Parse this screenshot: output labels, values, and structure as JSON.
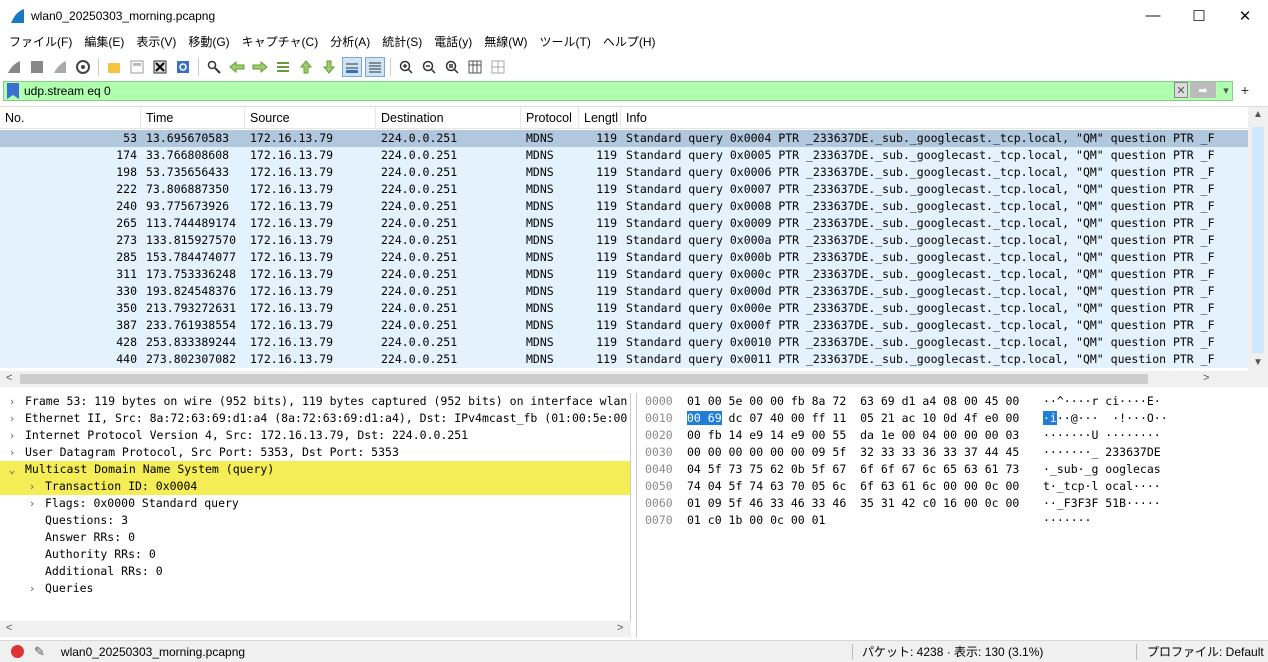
{
  "window": {
    "title": "wlan0_20250303_morning.pcapng",
    "minimize": "—",
    "maximize": "☐",
    "close": "✕"
  },
  "menu": [
    "ファイル(F)",
    "編集(E)",
    "表示(V)",
    "移動(G)",
    "キャプチャ(C)",
    "分析(A)",
    "統計(S)",
    "電話(y)",
    "無線(W)",
    "ツール(T)",
    "ヘルプ(H)"
  ],
  "filter": {
    "value": "udp.stream eq 0",
    "add": "+"
  },
  "columns": [
    "No.",
    "Time",
    "Source",
    "Destination",
    "Protocol",
    "Lengtl",
    "Info"
  ],
  "packets": [
    {
      "no": "53",
      "time": "13.695670583",
      "src": "172.16.13.79",
      "dst": "224.0.0.251",
      "proto": "MDNS",
      "len": "119",
      "info": "Standard query 0x0004 PTR _233637DE._sub._googlecast._tcp.local, \"QM\" question PTR _F"
    },
    {
      "no": "174",
      "time": "33.766808608",
      "src": "172.16.13.79",
      "dst": "224.0.0.251",
      "proto": "MDNS",
      "len": "119",
      "info": "Standard query 0x0005 PTR _233637DE._sub._googlecast._tcp.local, \"QM\" question PTR _F"
    },
    {
      "no": "198",
      "time": "53.735656433",
      "src": "172.16.13.79",
      "dst": "224.0.0.251",
      "proto": "MDNS",
      "len": "119",
      "info": "Standard query 0x0006 PTR _233637DE._sub._googlecast._tcp.local, \"QM\" question PTR _F"
    },
    {
      "no": "222",
      "time": "73.806887350",
      "src": "172.16.13.79",
      "dst": "224.0.0.251",
      "proto": "MDNS",
      "len": "119",
      "info": "Standard query 0x0007 PTR _233637DE._sub._googlecast._tcp.local, \"QM\" question PTR _F"
    },
    {
      "no": "240",
      "time": "93.775673926",
      "src": "172.16.13.79",
      "dst": "224.0.0.251",
      "proto": "MDNS",
      "len": "119",
      "info": "Standard query 0x0008 PTR _233637DE._sub._googlecast._tcp.local, \"QM\" question PTR _F"
    },
    {
      "no": "265",
      "time": "113.744489174",
      "src": "172.16.13.79",
      "dst": "224.0.0.251",
      "proto": "MDNS",
      "len": "119",
      "info": "Standard query 0x0009 PTR _233637DE._sub._googlecast._tcp.local, \"QM\" question PTR _F"
    },
    {
      "no": "273",
      "time": "133.815927570",
      "src": "172.16.13.79",
      "dst": "224.0.0.251",
      "proto": "MDNS",
      "len": "119",
      "info": "Standard query 0x000a PTR _233637DE._sub._googlecast._tcp.local, \"QM\" question PTR _F"
    },
    {
      "no": "285",
      "time": "153.784474077",
      "src": "172.16.13.79",
      "dst": "224.0.0.251",
      "proto": "MDNS",
      "len": "119",
      "info": "Standard query 0x000b PTR _233637DE._sub._googlecast._tcp.local, \"QM\" question PTR _F"
    },
    {
      "no": "311",
      "time": "173.753336248",
      "src": "172.16.13.79",
      "dst": "224.0.0.251",
      "proto": "MDNS",
      "len": "119",
      "info": "Standard query 0x000c PTR _233637DE._sub._googlecast._tcp.local, \"QM\" question PTR _F"
    },
    {
      "no": "330",
      "time": "193.824548376",
      "src": "172.16.13.79",
      "dst": "224.0.0.251",
      "proto": "MDNS",
      "len": "119",
      "info": "Standard query 0x000d PTR _233637DE._sub._googlecast._tcp.local, \"QM\" question PTR _F"
    },
    {
      "no": "350",
      "time": "213.793272631",
      "src": "172.16.13.79",
      "dst": "224.0.0.251",
      "proto": "MDNS",
      "len": "119",
      "info": "Standard query 0x000e PTR _233637DE._sub._googlecast._tcp.local, \"QM\" question PTR _F"
    },
    {
      "no": "387",
      "time": "233.761938554",
      "src": "172.16.13.79",
      "dst": "224.0.0.251",
      "proto": "MDNS",
      "len": "119",
      "info": "Standard query 0x000f PTR _233637DE._sub._googlecast._tcp.local, \"QM\" question PTR _F"
    },
    {
      "no": "428",
      "time": "253.833389244",
      "src": "172.16.13.79",
      "dst": "224.0.0.251",
      "proto": "MDNS",
      "len": "119",
      "info": "Standard query 0x0010 PTR _233637DE._sub._googlecast._tcp.local, \"QM\" question PTR _F"
    },
    {
      "no": "440",
      "time": "273.802307082",
      "src": "172.16.13.79",
      "dst": "224.0.0.251",
      "proto": "MDNS",
      "len": "119",
      "info": "Standard query 0x0011 PTR _233637DE._sub._googlecast._tcp.local, \"QM\" question PTR _F"
    }
  ],
  "details": [
    {
      "text": "Frame 53: 119 bytes on wire (952 bits), 119 bytes captured (952 bits) on interface wlan",
      "arrow": ">",
      "indent": 0
    },
    {
      "text": "Ethernet II, Src: 8a:72:63:69:d1:a4 (8a:72:63:69:d1:a4), Dst: IPv4mcast_fb (01:00:5e:00",
      "arrow": ">",
      "indent": 0
    },
    {
      "text": "Internet Protocol Version 4, Src: 172.16.13.79, Dst: 224.0.0.251",
      "arrow": ">",
      "indent": 0
    },
    {
      "text": "User Datagram Protocol, Src Port: 5353, Dst Port: 5353",
      "arrow": ">",
      "indent": 0
    },
    {
      "text": "Multicast Domain Name System (query)",
      "arrow": "v",
      "indent": 0,
      "hl": true
    },
    {
      "text": "Transaction ID: 0x0004",
      "arrow": ">",
      "indent": 1,
      "hl": true
    },
    {
      "text": "Flags: 0x0000 Standard query",
      "arrow": ">",
      "indent": 1
    },
    {
      "text": "Questions: 3",
      "arrow": "",
      "indent": 1
    },
    {
      "text": "Answer RRs: 0",
      "arrow": "",
      "indent": 1
    },
    {
      "text": "Authority RRs: 0",
      "arrow": "",
      "indent": 1
    },
    {
      "text": "Additional RRs: 0",
      "arrow": "",
      "indent": 1
    },
    {
      "text": "Queries",
      "arrow": ">",
      "indent": 1
    }
  ],
  "hex": [
    {
      "off": "0000",
      "bytes": "01 00 5e 00 00 fb 8a 72  63 69 d1 a4 08 00 45 00",
      "ascii": "··^····r ci····E·"
    },
    {
      "off": "0010",
      "sel": "00 69",
      "bytes": " dc 07 40 00 ff 11  05 21 ac 10 0d 4f e0 00",
      "asel": "·i",
      "ascii": "··@···  ·!···O··"
    },
    {
      "off": "0020",
      "bytes": "00 fb 14 e9 14 e9 00 55  da 1e 00 04 00 00 00 03",
      "ascii": "·······U ········"
    },
    {
      "off": "0030",
      "bytes": "00 00 00 00 00 00 09 5f  32 33 33 36 33 37 44 45",
      "ascii": "·······_ 233637DE"
    },
    {
      "off": "0040",
      "bytes": "04 5f 73 75 62 0b 5f 67  6f 6f 67 6c 65 63 61 73",
      "ascii": "·_sub·_g ooglecas"
    },
    {
      "off": "0050",
      "bytes": "74 04 5f 74 63 70 05 6c  6f 63 61 6c 00 00 0c 00",
      "ascii": "t·_tcp·l ocal····"
    },
    {
      "off": "0060",
      "bytes": "01 09 5f 46 33 46 33 46  35 31 42 c0 16 00 0c 00",
      "ascii": "··_F3F3F 51B·····"
    },
    {
      "off": "0070",
      "bytes": "01 c0 1b 00 0c 00 01",
      "ascii": "·······"
    }
  ],
  "status": {
    "file": "wlan0_20250303_morning.pcapng",
    "packets": "パケット: 4238 · 表示: 130 (3.1%)",
    "profile": "プロファイル: Default"
  }
}
